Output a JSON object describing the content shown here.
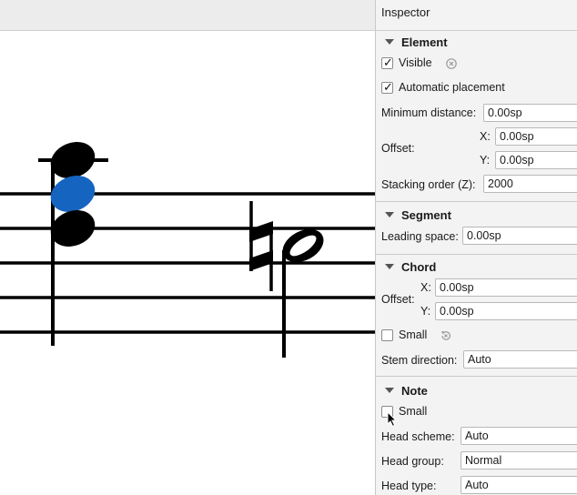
{
  "inspector": {
    "title": "Inspector",
    "element": {
      "header": "Element",
      "visible_label": "Visible",
      "visible_checked": true,
      "auto_place_label": "Automatic placement",
      "auto_place_checked": true,
      "min_distance_label": "Minimum distance:",
      "min_distance_value": "0.00sp",
      "offset_label": "Offset:",
      "offset_x_label": "X:",
      "offset_x_value": "0.00sp",
      "offset_y_label": "Y:",
      "offset_y_value": "0.00sp",
      "stacking_label": "Stacking order (Z):",
      "stacking_value": "2000"
    },
    "segment": {
      "header": "Segment",
      "leading_label": "Leading space:",
      "leading_value": "0.00sp"
    },
    "chord": {
      "header": "Chord",
      "offset_label": "Offset:",
      "offset_x_label": "X:",
      "offset_x_value": "0.00sp",
      "offset_y_label": "Y:",
      "offset_y_value": "0.00sp",
      "small_label": "Small",
      "small_checked": false,
      "stem_label": "Stem direction:",
      "stem_value": "Auto"
    },
    "note": {
      "header": "Note",
      "small_label": "Small",
      "small_checked": false,
      "head_scheme_label": "Head scheme:",
      "head_scheme_value": "Auto",
      "head_group_label": "Head group:",
      "head_group_value": "Normal",
      "head_type_label": "Head type:",
      "head_type_value": "Auto"
    }
  },
  "colors": {
    "selected_note": "#1565c0",
    "ink": "#000000",
    "panel_bg": "#f3f3f3"
  },
  "icons": {
    "reset": "reset-icon",
    "section_toggle": "triangle-down-icon",
    "cursor": "mouse-pointer-icon",
    "accidental": "natural-sign-icon"
  }
}
